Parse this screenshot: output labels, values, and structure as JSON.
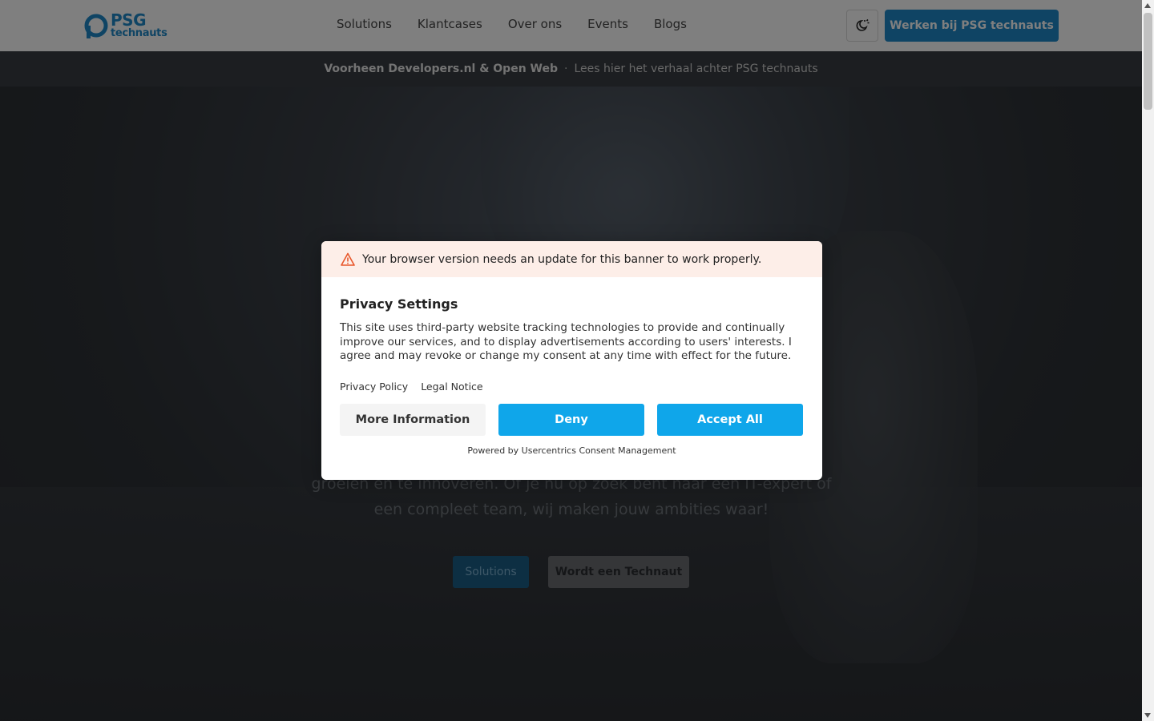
{
  "header": {
    "logo": {
      "title": "PSG",
      "subtitle": "technauts"
    },
    "nav": [
      {
        "label": "Solutions"
      },
      {
        "label": "Klantcases"
      },
      {
        "label": "Over ons"
      },
      {
        "label": "Events"
      },
      {
        "label": "Blogs"
      }
    ],
    "theme_icon": "theme-toggle-icon",
    "cta_label": "Werken bij PSG technauts"
  },
  "announcement": {
    "strong": "Voorheen Developers.nl & Open Web",
    "separator": "·",
    "link": "Lees hier het verhaal achter PSG technauts"
  },
  "hero": {
    "text": "groeien en te innoveren. Of je nu op zoek bent naar een IT-expert of een compleet team, wij maken jouw ambities waar!",
    "primary_button": "Solutions",
    "secondary_button": "Wordt een Technaut"
  },
  "consent": {
    "warning": "Your browser version needs an update for this banner to work properly.",
    "title": "Privacy Settings",
    "text": "This site uses third-party website tracking technologies to provide and continually improve our services, and to display advertisements according to users' interests. I agree and may revoke or change my consent at any time with effect for the future.",
    "links": [
      "Privacy Policy",
      "Legal Notice"
    ],
    "buttons": {
      "more": "More Information",
      "deny": "Deny",
      "accept": "Accept All"
    },
    "powered_by": "Powered by Usercentrics Consent Management"
  },
  "colors": {
    "brand": "#1e88c8",
    "consent_button": "#0fa6ea",
    "warning_bg": "#fdeee8",
    "warning_icon": "#e8562a"
  }
}
